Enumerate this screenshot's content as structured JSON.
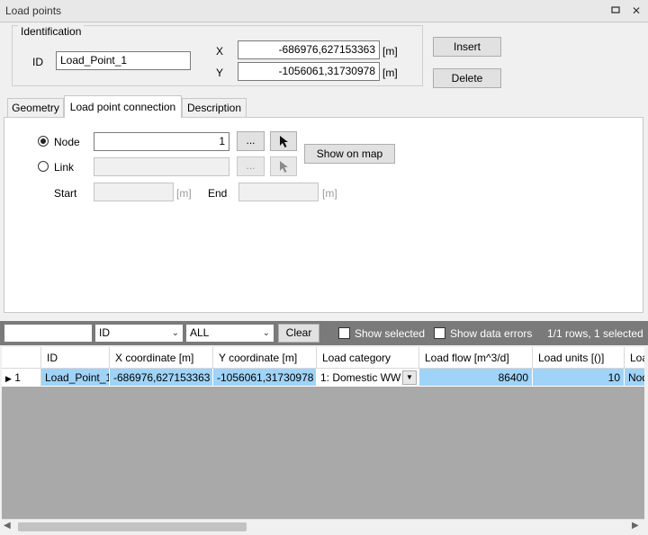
{
  "window": {
    "title": "Load points",
    "restore_icon": "restore-icon",
    "close_icon": "close-icon"
  },
  "identification": {
    "legend": "Identification",
    "id_label": "ID",
    "id_value": "Load_Point_1",
    "x_label": "X",
    "x_value": "-686976,627153363",
    "y_label": "Y",
    "y_value": "-1056061,31730978",
    "unit": "[m]"
  },
  "buttons": {
    "insert": "Insert",
    "delete": "Delete"
  },
  "tabs": [
    "Geometry",
    "Load point connection",
    "Description"
  ],
  "connection": {
    "node_label": "Node",
    "node_value": "1",
    "link_label": "Link",
    "link_value": "",
    "browse_label": "...",
    "show_on_map": "Show on map",
    "start_label": "Start",
    "end_label": "End",
    "unit": "[m]",
    "pointer_icon": "cursor-pointer-icon"
  },
  "gridbar": {
    "search_value": "",
    "field_select": "ID",
    "filter_select": "ALL",
    "clear": "Clear",
    "show_selected": "Show selected",
    "show_errors": "Show data errors",
    "status": "1/1 rows, 1 selected"
  },
  "table": {
    "columns": [
      "ID",
      "X coordinate [m]",
      "Y coordinate [m]",
      "Load category",
      "Load flow [m^3/d]",
      "Load units [()]",
      "Loa"
    ],
    "rows": [
      {
        "indicator": "1",
        "id": "Load_Point_1",
        "x": "-686976,627153363",
        "y": "-1056061,31730978",
        "category": "1: Domestic WW",
        "flow": "86400",
        "units": "10",
        "extra": "Nod"
      }
    ]
  }
}
